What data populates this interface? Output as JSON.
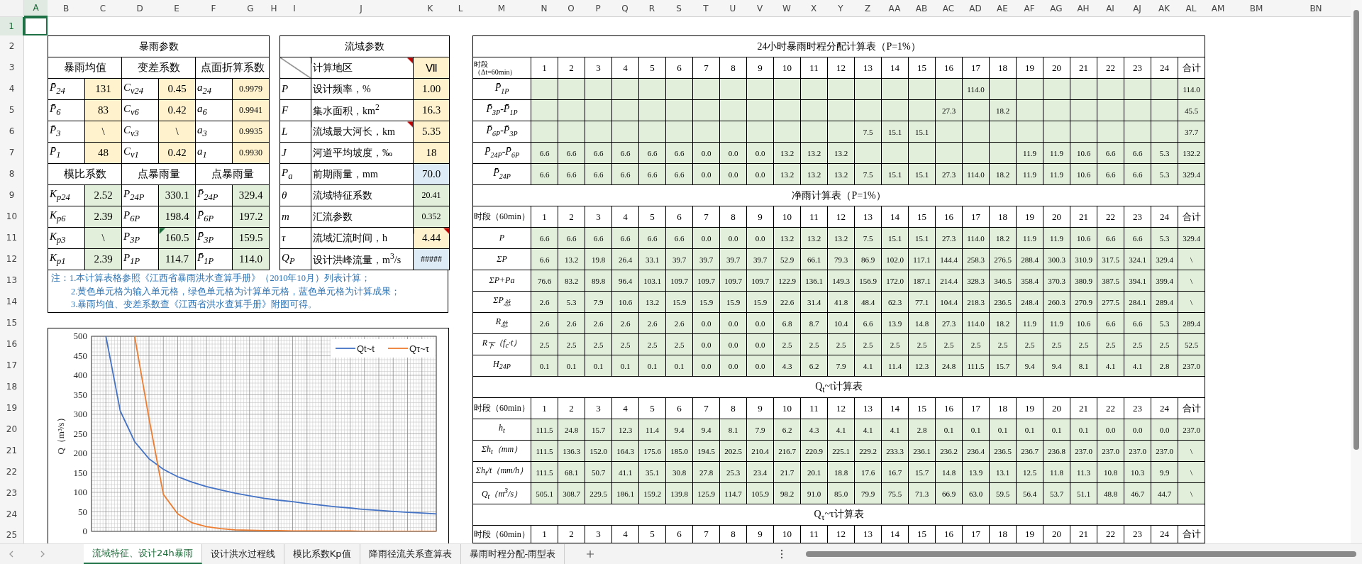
{
  "columns": [
    {
      "label": "A",
      "selected": true
    },
    {
      "label": "B",
      "selected": false
    },
    {
      "label": "C",
      "selected": false
    },
    {
      "label": "D",
      "selected": false
    },
    {
      "label": "E",
      "selected": false
    },
    {
      "label": "F",
      "selected": false
    },
    {
      "label": "G",
      "selected": false
    },
    {
      "label": "H",
      "selected": false
    },
    {
      "label": "I",
      "selected": false
    },
    {
      "label": "J",
      "selected": false
    },
    {
      "label": "K",
      "selected": false
    },
    {
      "label": "L",
      "selected": false
    },
    {
      "label": "M",
      "selected": false
    },
    {
      "label": "N",
      "selected": false
    },
    {
      "label": "O",
      "selected": false
    },
    {
      "label": "P",
      "selected": false
    },
    {
      "label": "Q",
      "selected": false
    },
    {
      "label": "R",
      "selected": false
    },
    {
      "label": "S",
      "selected": false
    },
    {
      "label": "T",
      "selected": false
    },
    {
      "label": "U",
      "selected": false
    },
    {
      "label": "V",
      "selected": false
    },
    {
      "label": "W",
      "selected": false
    },
    {
      "label": "X",
      "selected": false
    },
    {
      "label": "Y",
      "selected": false
    },
    {
      "label": "Z",
      "selected": false
    },
    {
      "label": "AA",
      "selected": false
    },
    {
      "label": "AB",
      "selected": false
    },
    {
      "label": "AC",
      "selected": false
    },
    {
      "label": "AD",
      "selected": false
    },
    {
      "label": "AE",
      "selected": false
    },
    {
      "label": "AF",
      "selected": false
    },
    {
      "label": "AG",
      "selected": false
    },
    {
      "label": "AH",
      "selected": false
    },
    {
      "label": "AI",
      "selected": false
    },
    {
      "label": "AJ",
      "selected": false
    },
    {
      "label": "AK",
      "selected": false
    },
    {
      "label": "AL",
      "selected": false
    },
    {
      "label": "AM",
      "selected": false
    },
    {
      "label": "BM",
      "selected": false
    },
    {
      "label": "BN",
      "selected": false
    }
  ],
  "rows": [
    {
      "label": "1",
      "selected": true
    },
    {
      "label": "2",
      "selected": false
    },
    {
      "label": "3",
      "selected": false
    },
    {
      "label": "4",
      "selected": false
    },
    {
      "label": "5",
      "selected": false
    },
    {
      "label": "6",
      "selected": false
    },
    {
      "label": "7",
      "selected": false
    },
    {
      "label": "8",
      "selected": false
    },
    {
      "label": "9",
      "selected": false
    },
    {
      "label": "10",
      "selected": false
    },
    {
      "label": "11",
      "selected": false
    },
    {
      "label": "12",
      "selected": false
    },
    {
      "label": "13",
      "selected": false
    },
    {
      "label": "14",
      "selected": false
    },
    {
      "label": "15",
      "selected": false
    },
    {
      "label": "16",
      "selected": false
    },
    {
      "label": "17",
      "selected": false
    },
    {
      "label": "18",
      "selected": false
    },
    {
      "label": "19",
      "selected": false
    },
    {
      "label": "20",
      "selected": false
    },
    {
      "label": "21",
      "selected": false
    },
    {
      "label": "22",
      "selected": false
    },
    {
      "label": "23",
      "selected": false
    },
    {
      "label": "24",
      "selected": false
    },
    {
      "label": "25",
      "selected": false
    }
  ],
  "storm": {
    "title": "暴雨参数",
    "headers": [
      "暴雨均值",
      "变差系数",
      "点面折算系数"
    ],
    "rows": [
      [
        {
          "label": "P̄$_{24}$",
          "value": "131",
          "kind": "input"
        },
        {
          "label": "C$_{v24}$",
          "value": "0.45",
          "kind": "input"
        },
        {
          "label": "a$_{24}$",
          "value": "0.9979",
          "kind": "input"
        }
      ],
      [
        {
          "label": "P̄$_{6}$",
          "value": "83",
          "kind": "input"
        },
        {
          "label": "C$_{v6}$",
          "value": "0.42",
          "kind": "input"
        },
        {
          "label": "a$_{6}$",
          "value": "0.9941",
          "kind": "input"
        }
      ],
      [
        {
          "label": "P̄$_{3}$",
          "value": "\\",
          "kind": "input"
        },
        {
          "label": "C$_{v3}$",
          "value": "\\",
          "kind": "input"
        },
        {
          "label": "a$_{3}$",
          "value": "0.9935",
          "kind": "input"
        }
      ],
      [
        {
          "label": "P̄$_{1}$",
          "value": "48",
          "kind": "input"
        },
        {
          "label": "C$_{v1}$",
          "value": "0.42",
          "kind": "input"
        },
        {
          "label": "a$_{1}$",
          "value": "0.9930",
          "kind": "input"
        }
      ]
    ],
    "subheaders": [
      "模比系数",
      "点暴雨量",
      "点暴雨量"
    ],
    "rows2": [
      [
        {
          "label": "K$_{p24}$",
          "value": "2.52",
          "kind": "calc",
          "error_mark": false
        },
        {
          "label": "P$_{24P}$",
          "value": "330.1",
          "kind": "calc",
          "error_mark": false
        },
        {
          "label": "P̄$_{24P}$",
          "value": "329.4",
          "kind": "calc",
          "error_mark": false
        }
      ],
      [
        {
          "label": "K$_{p6}$",
          "value": "2.39",
          "kind": "calc",
          "error_mark": false
        },
        {
          "label": "P$_{6P}$",
          "value": "198.4",
          "kind": "calc",
          "error_mark": false
        },
        {
          "label": "P̄$_{6P}$",
          "value": "197.2",
          "kind": "calc",
          "error_mark": false
        }
      ],
      [
        {
          "label": "K$_{p3}$",
          "value": "\\",
          "kind": "calc",
          "error_mark": false
        },
        {
          "label": "P$_{3P}$",
          "value": "160.5",
          "kind": "calc",
          "error_mark": true
        },
        {
          "label": "P̄$_{3P}$",
          "value": "159.5",
          "kind": "calc",
          "error_mark": false
        }
      ],
      [
        {
          "label": "K$_{p1}$",
          "value": "2.39",
          "kind": "calc",
          "error_mark": false
        },
        {
          "label": "P$_{1P}$",
          "value": "114.7",
          "kind": "calc",
          "error_mark": false
        },
        {
          "label": "P̄$_{1P}$",
          "value": "114.0",
          "kind": "calc",
          "error_mark": false
        }
      ]
    ]
  },
  "basin": {
    "title": "流域参数",
    "header": {
      "label": "计算地区",
      "value": "Ⅶ",
      "kind": "input",
      "comment_label": true,
      "comment_value": false
    },
    "rows": [
      {
        "symbol": "P",
        "label": "设计频率，%",
        "value": "1.00",
        "kind": "input",
        "comment_label": false,
        "comment_value": false
      },
      {
        "symbol": "F",
        "label": "集水面积，km$^{2}$",
        "value": "16.3",
        "kind": "input",
        "comment_label": false,
        "comment_value": false
      },
      {
        "symbol": "L",
        "label": "流域最大河长，km",
        "value": "5.35",
        "kind": "input",
        "comment_label": true,
        "comment_value": false
      },
      {
        "symbol": "J",
        "label": "河道平均坡度，‰",
        "value": "18",
        "kind": "input",
        "comment_label": false,
        "comment_value": false
      },
      {
        "symbol": "P$_{a}$",
        "label": "前期雨量，mm",
        "value": "70.0",
        "kind": "result",
        "comment_label": false,
        "comment_value": false
      },
      {
        "symbol": "θ",
        "label": "流域特征系数",
        "value": "20.41",
        "kind": "calc",
        "comment_label": false,
        "comment_value": false
      },
      {
        "symbol": "m",
        "label": "汇流参数",
        "value": "0.352",
        "kind": "calc",
        "comment_label": false,
        "comment_value": false
      },
      {
        "symbol": "τ",
        "label": "流域汇流时间，h",
        "value": "4.44",
        "kind": "input",
        "comment_label": false,
        "comment_value": true
      },
      {
        "symbol": "Q$_{P}$",
        "label": "设计洪峰流量，m$^{3}$/s",
        "value": "#####",
        "kind": "result",
        "comment_label": false,
        "comment_value": false
      }
    ]
  },
  "notes": [
    "注：1.本计算表格参照《江西省暴雨洪水查算手册》（2010年10月）列表计算；",
    "2.黄色单元格为输入单元格，绿色单元格为计算单元格，蓝色单元格为计算成果；",
    "3.暴雨均值、变差系数查《江西省洪水查算手册》附图可得。"
  ],
  "chart": {
    "chart_data": {
      "type": "line",
      "ylabel": "Q（m³/s）",
      "categories": [
        null,
        null,
        null,
        null,
        null,
        null,
        null,
        null,
        null,
        null,
        null,
        null,
        null,
        null,
        null,
        null,
        null,
        null,
        null,
        null,
        null,
        null,
        null,
        null
      ],
      "grid": true,
      "legend": true,
      "ylim": [
        0,
        500
      ],
      "yticks": [
        0,
        50,
        100,
        150,
        200,
        250,
        300,
        350,
        400,
        450,
        500
      ],
      "series": [
        {
          "name": "Qt~t",
          "color": "#4472c4",
          "values": [
            500,
            309,
            230,
            186,
            159,
            140,
            126,
            115,
            106,
            98,
            91,
            85,
            80,
            76,
            71,
            67,
            63,
            60,
            56,
            54,
            51,
            49,
            47,
            45
          ]
        },
        {
          "name": "Qτ~τ",
          "color": "#ed7d31",
          "values": [
            null,
            null,
            500,
            290,
            95,
            45,
            22,
            12,
            7,
            4,
            3,
            2,
            2,
            1,
            1,
            1,
            1,
            1,
            0,
            0,
            0,
            0,
            0,
            0
          ]
        }
      ]
    }
  },
  "sections": [
    {
      "title": "24小时暴雨时程分配计算表（P=1%）",
      "period_label": "时段（Δt=60min）",
      "columns": [
        "1",
        "2",
        "3",
        "4",
        "5",
        "6",
        "7",
        "8",
        "9",
        "10",
        "11",
        "12",
        "13",
        "14",
        "15",
        "16",
        "17",
        "18",
        "19",
        "20",
        "21",
        "22",
        "23",
        "24",
        "合计"
      ],
      "rows": [
        {
          "label": "P̄$_{1P}$",
          "cells": [
            null,
            null,
            null,
            null,
            null,
            null,
            null,
            null,
            null,
            null,
            null,
            null,
            null,
            null,
            null,
            null,
            "114.0",
            null,
            null,
            null,
            null,
            null,
            null,
            null,
            "114.0"
          ]
        },
        {
          "label": "P̄$_{3P}$-P̄$_{1P}$",
          "cells": [
            null,
            null,
            null,
            null,
            null,
            null,
            null,
            null,
            null,
            null,
            null,
            null,
            null,
            null,
            null,
            "27.3",
            null,
            "18.2",
            null,
            null,
            null,
            null,
            null,
            null,
            "45.5"
          ]
        },
        {
          "label": "P̄$_{6P}$-P̄$_{3P}$",
          "cells": [
            null,
            null,
            null,
            null,
            null,
            null,
            null,
            null,
            null,
            null,
            null,
            null,
            "7.5",
            "15.1",
            "15.1",
            null,
            null,
            null,
            null,
            null,
            null,
            null,
            null,
            null,
            "37.7"
          ]
        },
        {
          "label": "P̄$_{24P}$-P̄$_{6P}$",
          "cells": [
            "6.6",
            "6.6",
            "6.6",
            "6.6",
            "6.6",
            "6.6",
            "0.0",
            "0.0",
            "0.0",
            "13.2",
            "13.2",
            "13.2",
            null,
            null,
            null,
            null,
            null,
            null,
            "11.9",
            "11.9",
            "10.6",
            "6.6",
            "6.6",
            "5.3",
            "132.2"
          ]
        },
        {
          "label": "P̄$_{24P}$",
          "cells": [
            "6.6",
            "6.6",
            "6.6",
            "6.6",
            "6.6",
            "6.6",
            "0.0",
            "0.0",
            "0.0",
            "13.2",
            "13.2",
            "13.2",
            "7.5",
            "15.1",
            "15.1",
            "27.3",
            "114.0",
            "18.2",
            "11.9",
            "11.9",
            "10.6",
            "6.6",
            "6.6",
            "5.3",
            "329.4"
          ]
        }
      ]
    },
    {
      "title": "净雨计算表（P=1%）",
      "period_label": "时段（60min）",
      "columns": [
        "1",
        "2",
        "3",
        "4",
        "5",
        "6",
        "7",
        "8",
        "9",
        "10",
        "11",
        "12",
        "13",
        "14",
        "15",
        "16",
        "17",
        "18",
        "19",
        "20",
        "21",
        "22",
        "23",
        "24",
        "合计"
      ],
      "rows": [
        {
          "label": "P",
          "cells": [
            "6.6",
            "6.6",
            "6.6",
            "6.6",
            "6.6",
            "6.6",
            "0.0",
            "0.0",
            "0.0",
            "13.2",
            "13.2",
            "13.2",
            "7.5",
            "15.1",
            "15.1",
            "27.3",
            "114.0",
            "18.2",
            "11.9",
            "11.9",
            "10.6",
            "6.6",
            "6.6",
            "5.3",
            "329.4"
          ]
        },
        {
          "label": "ΣP",
          "cells": [
            "6.6",
            "13.2",
            "19.8",
            "26.4",
            "33.1",
            "39.7",
            "39.7",
            "39.7",
            "39.7",
            "52.9",
            "66.1",
            "79.3",
            "86.9",
            "102.0",
            "117.1",
            "144.4",
            "258.3",
            "276.5",
            "288.4",
            "300.3",
            "310.9",
            "317.5",
            "324.1",
            "329.4",
            "\\"
          ]
        },
        {
          "label": "ΣP+Pa",
          "cells": [
            "76.6",
            "83.2",
            "89.8",
            "96.4",
            "103.1",
            "109.7",
            "109.7",
            "109.7",
            "109.7",
            "122.9",
            "136.1",
            "149.3",
            "156.9",
            "172.0",
            "187.1",
            "214.4",
            "328.3",
            "346.5",
            "358.4",
            "370.3",
            "380.9",
            "387.5",
            "394.1",
            "399.4",
            "\\"
          ]
        },
        {
          "label": "ΣP$_{总}$",
          "cells": [
            "2.6",
            "5.3",
            "7.9",
            "10.6",
            "13.2",
            "15.9",
            "15.9",
            "15.9",
            "15.9",
            "22.6",
            "31.4",
            "41.8",
            "48.4",
            "62.3",
            "77.1",
            "104.4",
            "218.3",
            "236.5",
            "248.4",
            "260.3",
            "270.9",
            "277.5",
            "284.1",
            "289.4",
            "\\"
          ]
        },
        {
          "label": "R$_{总}$",
          "cells": [
            "2.6",
            "2.6",
            "2.6",
            "2.6",
            "2.6",
            "2.6",
            "0.0",
            "0.0",
            "0.0",
            "6.8",
            "8.7",
            "10.4",
            "6.6",
            "13.9",
            "14.8",
            "27.3",
            "114.0",
            "18.2",
            "11.9",
            "11.9",
            "10.6",
            "6.6",
            "6.6",
            "5.3",
            "289.4"
          ]
        },
        {
          "label": "R$_{下}$（f$_{c}$·t）",
          "cells": [
            "2.5",
            "2.5",
            "2.5",
            "2.5",
            "2.5",
            "2.5",
            "0.0",
            "0.0",
            "0.0",
            "2.5",
            "2.5",
            "2.5",
            "2.5",
            "2.5",
            "2.5",
            "2.5",
            "2.5",
            "2.5",
            "2.5",
            "2.5",
            "2.5",
            "2.5",
            "2.5",
            "2.5",
            "52.5"
          ]
        },
        {
          "label": "H$_{24P}$",
          "cells": [
            "0.1",
            "0.1",
            "0.1",
            "0.1",
            "0.1",
            "0.1",
            "0.0",
            "0.0",
            "0.0",
            "4.3",
            "6.2",
            "7.9",
            "4.1",
            "11.4",
            "12.3",
            "24.8",
            "111.5",
            "15.7",
            "9.4",
            "9.4",
            "8.1",
            "4.1",
            "4.1",
            "2.8",
            "237.0"
          ]
        }
      ]
    },
    {
      "title": "Q$_{t}$~t计算表",
      "period_label": "时段（60min）",
      "columns": [
        "1",
        "2",
        "3",
        "4",
        "5",
        "6",
        "7",
        "8",
        "9",
        "10",
        "11",
        "12",
        "13",
        "14",
        "15",
        "16",
        "17",
        "18",
        "19",
        "20",
        "21",
        "22",
        "23",
        "24",
        "合计"
      ],
      "rows": [
        {
          "label": "h$_{t}$",
          "cells": [
            "111.5",
            "24.8",
            "15.7",
            "12.3",
            "11.4",
            "9.4",
            "9.4",
            "8.1",
            "7.9",
            "6.2",
            "4.3",
            "4.1",
            "4.1",
            "4.1",
            "2.8",
            "0.1",
            "0.1",
            "0.1",
            "0.1",
            "0.1",
            "0.1",
            "0.0",
            "0.0",
            "0.0",
            "237.0"
          ]
        },
        {
          "label": "Σh$_{t}$（mm）",
          "cells": [
            "111.5",
            "136.3",
            "152.0",
            "164.3",
            "175.6",
            "185.0",
            "194.5",
            "202.5",
            "210.4",
            "216.7",
            "220.9",
            "225.1",
            "229.2",
            "233.3",
            "236.1",
            "236.2",
            "236.4",
            "236.5",
            "236.7",
            "236.8",
            "237.0",
            "237.0",
            "237.0",
            "237.0",
            "\\"
          ]
        },
        {
          "label": "Σh$_{t}$/t（mm/h）",
          "cells": [
            "111.5",
            "68.1",
            "50.7",
            "41.1",
            "35.1",
            "30.8",
            "27.8",
            "25.3",
            "23.4",
            "21.7",
            "20.1",
            "18.8",
            "17.6",
            "16.7",
            "15.7",
            "14.8",
            "13.9",
            "13.1",
            "12.5",
            "11.8",
            "11.3",
            "10.8",
            "10.3",
            "9.9",
            "\\"
          ]
        },
        {
          "label": "Q$_{t}$（m$^{3}$/s）",
          "cells": [
            "505.1",
            "308.7",
            "229.5",
            "186.1",
            "159.2",
            "139.8",
            "125.9",
            "114.7",
            "105.9",
            "98.2",
            "91.0",
            "85.0",
            "79.9",
            "75.5",
            "71.3",
            "66.9",
            "63.0",
            "59.5",
            "56.4",
            "53.7",
            "51.1",
            "48.8",
            "46.7",
            "44.7",
            "\\"
          ]
        }
      ]
    },
    {
      "title": "Q$_{τ}$~τ计算表",
      "period_label": "时段（60min）",
      "columns": [
        "1",
        "2",
        "3",
        "4",
        "5",
        "6",
        "7",
        "8",
        "9",
        "10",
        "11",
        "12",
        "13",
        "14",
        "15",
        "16",
        "17",
        "18",
        "19",
        "20",
        "21",
        "22",
        "23",
        "24",
        "合计"
      ]
    }
  ],
  "sheet_tabs": [
    {
      "label": "流域特征、设计24h暴雨",
      "selected": true
    },
    {
      "label": "设计洪水过程线",
      "selected": false
    },
    {
      "label": "模比系数Kp值",
      "selected": false
    },
    {
      "label": "降雨径流关系查算表",
      "selected": false
    },
    {
      "label": "暴雨时程分配-雨型表",
      "selected": false
    }
  ]
}
